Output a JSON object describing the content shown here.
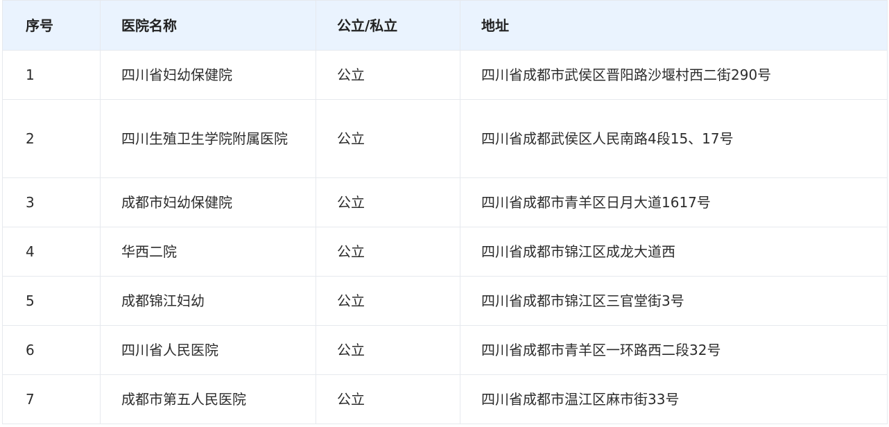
{
  "table": {
    "headers": [
      "序号",
      "医院名称",
      "公立/私立",
      "地址"
    ],
    "rows": [
      {
        "no": "1",
        "name": "四川省妇幼保健院",
        "type": "公立",
        "address": "四川省成都市武侯区晋阳路沙堰村西二街290号"
      },
      {
        "no": "2",
        "name": "四川生殖卫生学院附属医院",
        "type": "公立",
        "address": "四川省成都武侯区人民南路4段15、17号"
      },
      {
        "no": "3",
        "name": "成都市妇幼保健院",
        "type": "公立",
        "address": "四川省成都市青羊区日月大道1617号"
      },
      {
        "no": "4",
        "name": "华西二院",
        "type": "公立",
        "address": "四川省成都市锦江区成龙大道西"
      },
      {
        "no": "5",
        "name": "成都锦江妇幼",
        "type": "公立",
        "address": "四川省成都市锦江区三官堂街3号"
      },
      {
        "no": "6",
        "name": "四川省人民医院",
        "type": "公立",
        "address": "四川省成都市青羊区一环路西二段32号"
      },
      {
        "no": "7",
        "name": "成都市第五人民医院",
        "type": "公立",
        "address": "四川省成都市温江区麻市街33号"
      }
    ]
  }
}
